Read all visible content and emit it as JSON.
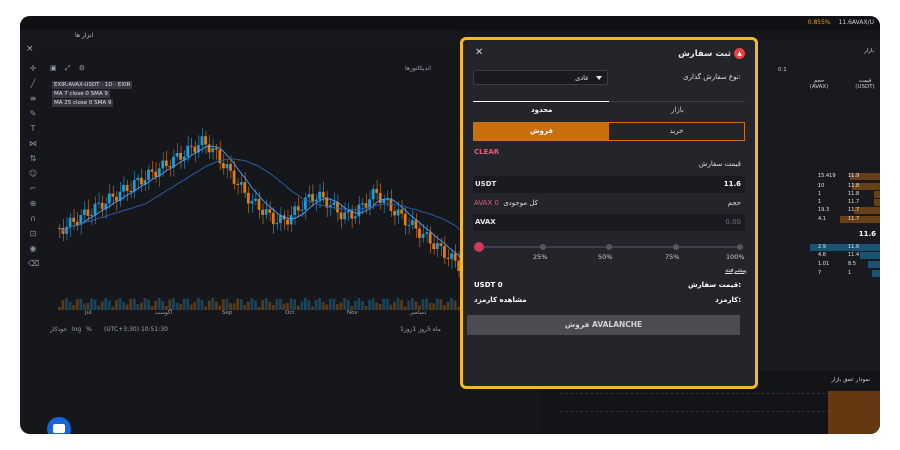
{
  "topbar": {
    "ticker_pct": "0.855%",
    "ticker_price": "11.6AVAX/U"
  },
  "tabbar": {
    "tools_label": "ابزار ها"
  },
  "chart_toolbar": {
    "indicators_label": "اندیکاتورها"
  },
  "legend": {
    "symbol": "EXIR:AVAX-USDT · 1D · EXIR",
    "ma7": "MA 7 close 0 SMA 9",
    "ma25": "MA 25 close 0 SMA 9"
  },
  "xaxis_labels": [
    "Jul",
    "آگوست",
    "Sep",
    "Oct",
    "Nov",
    "دسامبر"
  ],
  "bottombar": {
    "ranges": "1ماه  5روز  1روز",
    "time": "(UTC+3:30) 10:51:30",
    "pct": "%",
    "log": "log",
    "auto": "خودکار"
  },
  "orderbook": {
    "title": "بازار",
    "step": "0.1",
    "headers": [
      "قیمت (USDT)",
      "حجم (AVAX)"
    ],
    "last_price": "11.6",
    "asks": [
      {
        "price": "11.9",
        "qty": "15.419"
      },
      {
        "price": "11.8",
        "qty": "10"
      },
      {
        "price": "11.8",
        "qty": "1"
      },
      {
        "price": "11.7",
        "qty": "1"
      },
      {
        "price": "11.7",
        "qty": "19.3"
      },
      {
        "price": "11.7",
        "qty": "4.1"
      }
    ],
    "bids": [
      {
        "price": "11.6",
        "qty": "2.9"
      },
      {
        "price": "11.4",
        "qty": "4.8"
      },
      {
        "price": "8.5",
        "qty": "1.01"
      },
      {
        "price": "1",
        "qty": "7"
      }
    ],
    "depth_title": "نمودار عمق بازار"
  },
  "dialog": {
    "title": "ثبت سفارش",
    "order_type_label": "نوع سفارش گذاری:",
    "order_type_value": "عادی",
    "tab_market": "بازار",
    "tab_limit": "محدود",
    "buy_label": "خرید",
    "sell_label": "فروش",
    "clear_label": "CLEAR",
    "price_label": "قیمت سفارش",
    "price_unit": "USDT",
    "price_value": "11.6",
    "volume_label": "حجم",
    "available_label": "کل موجودی",
    "available_value": "AVAX 0",
    "volume_unit": "AVAX",
    "volume_placeholder": "0.00",
    "slider_percent": 0,
    "percents": [
      "100%",
      "75%",
      "50%",
      "25%"
    ],
    "advanced_label": "پیشرفته",
    "order_price_label": "قیمت سفارش:",
    "order_price_value": "USDT 0",
    "fee_label": "کارمزد:",
    "fee_value": "مشاهده کارمزد",
    "submit_label": "فروش AVALANCHE"
  },
  "colors": {
    "highlight_border": "#f5b730",
    "sell_accent": "#c96f10",
    "clear": "#e25a7a",
    "up_candle": "#1f9bd6",
    "down_candle": "#e07b14"
  }
}
